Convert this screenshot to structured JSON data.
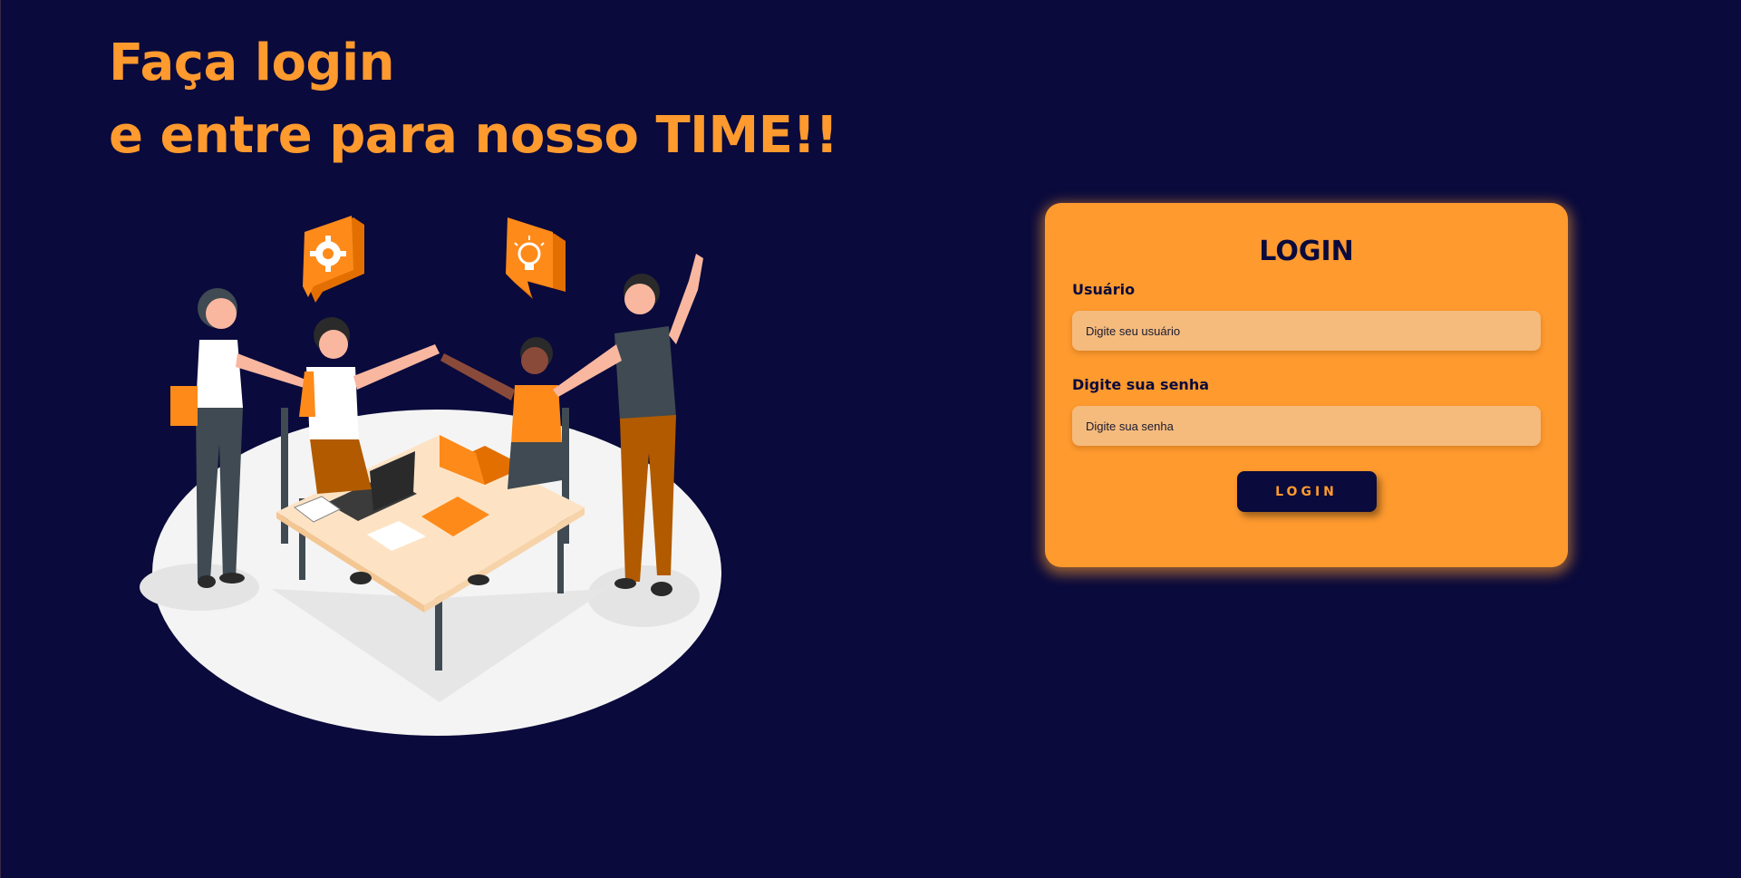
{
  "headline": {
    "line1": "Faça login",
    "line2": "e entre para nosso TIME!!"
  },
  "illustration": {
    "icons": [
      "gear-icon",
      "lightbulb-icon"
    ]
  },
  "login_card": {
    "title": "LOGIN",
    "username": {
      "label": "Usuário",
      "placeholder": "Digite seu usuário",
      "value": ""
    },
    "password": {
      "label": "Digite sua senha",
      "placeholder": "Digite sua senha",
      "value": ""
    },
    "submit_label": "LOGIN"
  },
  "colors": {
    "background": "#0a0a3c",
    "accent": "#fe9a2e",
    "input_bg": "#f5bb7d"
  }
}
